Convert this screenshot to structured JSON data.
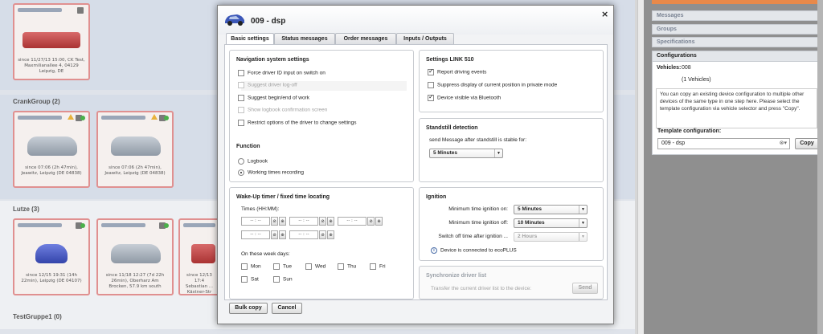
{
  "background": {
    "groups": [
      "CrankGroup (2)",
      "Lutze (3)",
      "TestGruppe1 (0)"
    ],
    "cards": {
      "c1": "since 11/27/13 15:00, CK Test, Maxmilianallee 4, 04129 Leipzig, DE",
      "c2": "since 07:06 (2h 47min), Jeawitz, Leipzig (DE 04838)",
      "c3": "since 07:06 (2h 47min), Jeawitz, Leipzig (DE 04838)",
      "c4": "since 12/15 19:31 (14h 22min), Leipzig (DE 04107)",
      "c5": "since 11/18 12:27 (7d 22h 26min), Oberharz Am Brocken, 57.9 km south",
      "c6": "since 12/13 17:4 Sebastian ... Kästner-Str"
    }
  },
  "right_panel": {
    "accordion": [
      "Messages",
      "Groups",
      "Specifications"
    ],
    "config_header": "Configurations",
    "vehicles_label": "Vehicles:",
    "vehicles_value": "008",
    "vehicles_count": "(1 Vehicles)",
    "info_text": "You can copy an existing device configuration to multiple other devices of the same type in one step here. Please select the template configuration via vehicle selector and press \"Copy\".",
    "template_label": "Template configuration:",
    "template_value": "009 - dsp",
    "copy_button": "Copy"
  },
  "modal": {
    "title": "009 - dsp",
    "close": "×",
    "tabs": [
      "Basic settings",
      "Status messages",
      "Order messages",
      "Inputs / Outputs"
    ],
    "nav": {
      "title": "Navigation system settings",
      "items": [
        {
          "label": "Force driver ID input on switch on",
          "checked": false,
          "disabled": false
        },
        {
          "label": "Suggest driver log-off",
          "checked": false,
          "disabled": true
        },
        {
          "label": "Suggest begin/end of work",
          "checked": false,
          "disabled": false
        },
        {
          "label": "Show logbook confirmation screen",
          "checked": false,
          "disabled": true
        },
        {
          "label": "Restrict options of the driver to change settings",
          "checked": false,
          "disabled": false
        }
      ],
      "function_title": "Function",
      "function_options": [
        "Logbook",
        "Working times recording"
      ]
    },
    "link": {
      "title": "Settings  LINK 510",
      "items": [
        {
          "label": "Report driving events",
          "checked": true
        },
        {
          "label": "Suppress display of current position in private mode",
          "checked": false
        },
        {
          "label": "Device visible via Bluetooth",
          "checked": true
        }
      ]
    },
    "standstill": {
      "title": "Standstill detection",
      "label": "send Message after standstill is stable for:",
      "value": "5 Minutes"
    },
    "wakeup": {
      "title": "Wake-Up timer / fixed time locating",
      "times_label": "Times (HH:MM):",
      "time_placeholder": "-- : --",
      "btn_clear": "⊘",
      "btn_add": "⊕",
      "days_label": "On these week days:",
      "days": [
        "Mon",
        "Tue",
        "Wed",
        "Thu",
        "Fri",
        "Sat",
        "Sun"
      ]
    },
    "ignition": {
      "title": "Ignition",
      "on_label": "Minimum time ignition on:",
      "on_value": "5 Minutes",
      "off_label": "Minimum time ignition off:",
      "off_value": "10 Minutes",
      "switch_label": "Switch off time after ignition ...",
      "switch_value": "2 Hours",
      "info": "Device is connected to ecoPLUS"
    },
    "sync": {
      "title": "Synchronize driver list",
      "label": "Transfer the current driver list to the device:",
      "button": "Send"
    },
    "footer": {
      "bulk_copy": "Bulk copy",
      "cancel": "Cancel"
    }
  }
}
